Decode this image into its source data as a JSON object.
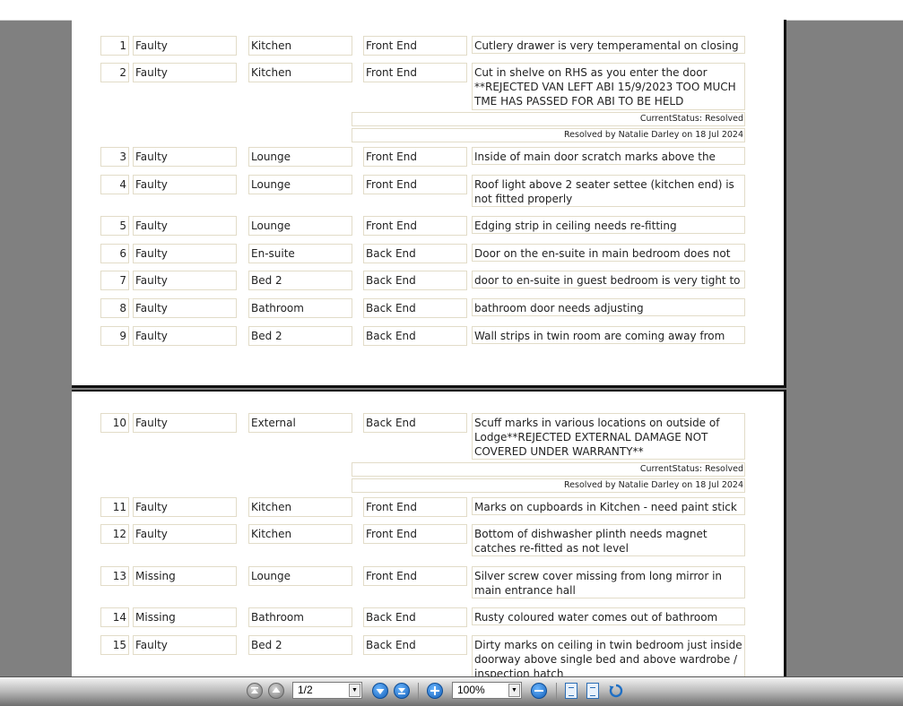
{
  "toolbar": {
    "page_value": "1/2",
    "zoom_value": "100%",
    "icons": {
      "first": "first-page-icon",
      "prev": "previous-page-icon",
      "next": "next-page-icon",
      "last": "last-page-icon",
      "zoom_in": "zoom-in-icon",
      "zoom_out": "zoom-out-icon",
      "single_page": "single-page-view-icon",
      "continuous": "continuous-view-icon",
      "rotate": "rotate-icon"
    }
  },
  "page1": {
    "rows": [
      {
        "num": "1",
        "type": "Faulty",
        "room": "Kitchen",
        "area": "Front End",
        "desc": "Cutlery drawer is very temperamental on closing"
      },
      {
        "num": "2",
        "type": "Faulty",
        "room": "Kitchen",
        "area": "Front End",
        "desc": "Cut in shelve on RHS as you enter the door **REJECTED VAN LEFT ABI 15/9/2023 TOO MUCH TME HAS PASSED FOR ABI TO BE HELD ACCOUNTABLE**",
        "status": "CurrentStatus: Resolved",
        "resolved": "Resolved by Natalie Darley on 18 Jul 2024"
      },
      {
        "num": "3",
        "type": "Faulty",
        "room": "Lounge",
        "area": "Front End",
        "desc": "Inside of main door scratch marks above the handle"
      },
      {
        "num": "4",
        "type": "Faulty",
        "room": "Lounge",
        "area": "Front End",
        "desc": "Roof light above 2 seater settee (kitchen end) is not fitted properly"
      },
      {
        "num": "5",
        "type": "Faulty",
        "room": "Lounge",
        "area": "Front End",
        "desc": "Edging strip in ceiling needs re-fitting"
      },
      {
        "num": "6",
        "type": "Faulty",
        "room": "En-suite",
        "area": "Back End",
        "desc": "Door on the en-suite in main bedroom does not shut"
      },
      {
        "num": "7",
        "type": "Faulty",
        "room": "Bed 2",
        "area": "Back End",
        "desc": "door to en-suite in guest bedroom is very tight to shut"
      },
      {
        "num": "8",
        "type": "Faulty",
        "room": "Bathroom",
        "area": "Back End",
        "desc": "bathroom door needs adjusting"
      },
      {
        "num": "9",
        "type": "Faulty",
        "room": "Bed 2",
        "area": "Back End",
        "desc": "Wall strips in twin room are coming away from wall"
      }
    ]
  },
  "page2": {
    "rows": [
      {
        "num": "10",
        "type": "Faulty",
        "room": "External",
        "area": "Back End",
        "desc": "Scuff marks in various locations on outside of Lodge**REJECTED EXTERNAL DAMAGE NOT COVERED UNDER WARRANTY**",
        "status": "CurrentStatus: Resolved",
        "resolved": "Resolved by Natalie Darley on 18 Jul 2024"
      },
      {
        "num": "11",
        "type": "Faulty",
        "room": "Kitchen",
        "area": "Front End",
        "desc": "Marks on cupboards in Kitchen - need paint stick"
      },
      {
        "num": "12",
        "type": "Faulty",
        "room": "Kitchen",
        "area": "Front End",
        "desc": "Bottom of dishwasher plinth needs magnet catches re-fitted as not level"
      },
      {
        "num": "13",
        "type": "Missing",
        "room": "Lounge",
        "area": "Front End",
        "desc": "Silver screw cover missing from long mirror in main entrance hall"
      },
      {
        "num": "14",
        "type": "Missing",
        "room": "Bathroom",
        "area": "Back End",
        "desc": "Rusty coloured water comes out of bathroom sink tap"
      },
      {
        "num": "15",
        "type": "Faulty",
        "room": "Bed 2",
        "area": "Back End",
        "desc": "Dirty marks on ceiling in twin bedroom just inside doorway above single bed and above wardrobe / inspection hatch"
      }
    ]
  }
}
